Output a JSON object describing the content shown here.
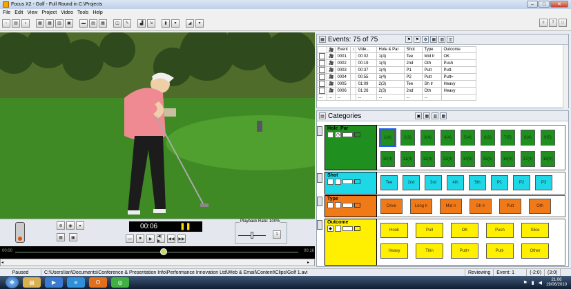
{
  "window": {
    "title": "Focus X2 - Golf - Full Round in C:\\Projects",
    "min": "–",
    "max": "□",
    "close": "✕",
    "right_icons": [
      "◊",
      "?",
      "□"
    ]
  },
  "menu": [
    "File",
    "Edit",
    "View",
    "Project",
    "Video",
    "Tools",
    "Help"
  ],
  "player": {
    "time": "00:06",
    "pause": "❚❚",
    "playback_label": "Playback Rate: 100%",
    "time_start": "00:00",
    "time_end": "00:16",
    "transport": [
      "■",
      "▶",
      "◀|▶",
      "◀◀",
      "▶▶"
    ]
  },
  "events_panel": {
    "title": "Events: 75 of 75",
    "columns": [
      "",
      "",
      "Event",
      "",
      "Vide...",
      "Hole & Par",
      "Shot",
      "Type",
      "Outcome"
    ],
    "rows": [
      [
        "0001",
        "00:02",
        "1(4)",
        "Tee",
        "Mid Ir",
        "OK"
      ],
      [
        "0002",
        "00:19",
        "1(4)",
        "2nd",
        "Oth",
        "Push"
      ],
      [
        "0003",
        "00:37",
        "1(4)",
        "P1",
        "Putt",
        "Putt-"
      ],
      [
        "0004",
        "00:55",
        "1(4)",
        "P2",
        "Putt",
        "Putt+"
      ],
      [
        "0005",
        "01:09",
        "2(3)",
        "Tee",
        "Sh Ir",
        "Heavy"
      ],
      [
        "0006",
        "01:26",
        "2(3)",
        "2nd",
        "Oth",
        "Heavy"
      ]
    ],
    "footer": [
      "...",
      "...",
      "...",
      "...",
      "...",
      "...",
      "..."
    ]
  },
  "categories": {
    "title": "Categories",
    "groups": [
      {
        "name": "Hole_Par",
        "color": "#1f8f1f",
        "items": [
          "1(4)",
          "2(3)",
          "3(4)",
          "4(4)",
          "5(4)",
          "6(3)",
          "7(5)",
          "8(4)",
          "9(5)",
          "10(4)",
          "11(4)",
          "12(4)",
          "13(4)",
          "14(3)",
          "15(5)",
          "16(4)",
          "17(4)",
          "18(4)"
        ]
      },
      {
        "name": "Shot",
        "color": "#1ed8e8",
        "items": [
          "Tee",
          "2nd",
          "3rd",
          "4th",
          "5th",
          "P1",
          "P2",
          "P3"
        ]
      },
      {
        "name": "Type",
        "color": "#f07a18",
        "items": [
          "Drive",
          "Long Ir",
          "Mid Ir",
          "Sh Ir",
          "Putt",
          "Oth"
        ]
      },
      {
        "name": "Outcome",
        "color": "#ffef00",
        "items": [
          "Hook",
          "Pull",
          "OK",
          "Push",
          "Slice",
          "Heavy",
          "Thin",
          "Putt+",
          "Putt-",
          "Other"
        ]
      }
    ]
  },
  "status": {
    "state": "Paused",
    "path": "C:\\Users\\Ian\\Documents\\Conference & Presentation Info\\Performance Innovation Ltd\\Web & Email\\Content\\Clips\\Golf 1.avi",
    "mode": "Reviewing",
    "event": "Event: 1",
    "coord1": "(-2:0)",
    "coord2": "(3:0)"
  },
  "taskbar": {
    "time": "21:06",
    "date": "19/06/2010"
  },
  "colors": {
    "hole": "#1f8f1f",
    "shot": "#1ed8e8",
    "type": "#f07a18",
    "outcome": "#ffef00"
  }
}
